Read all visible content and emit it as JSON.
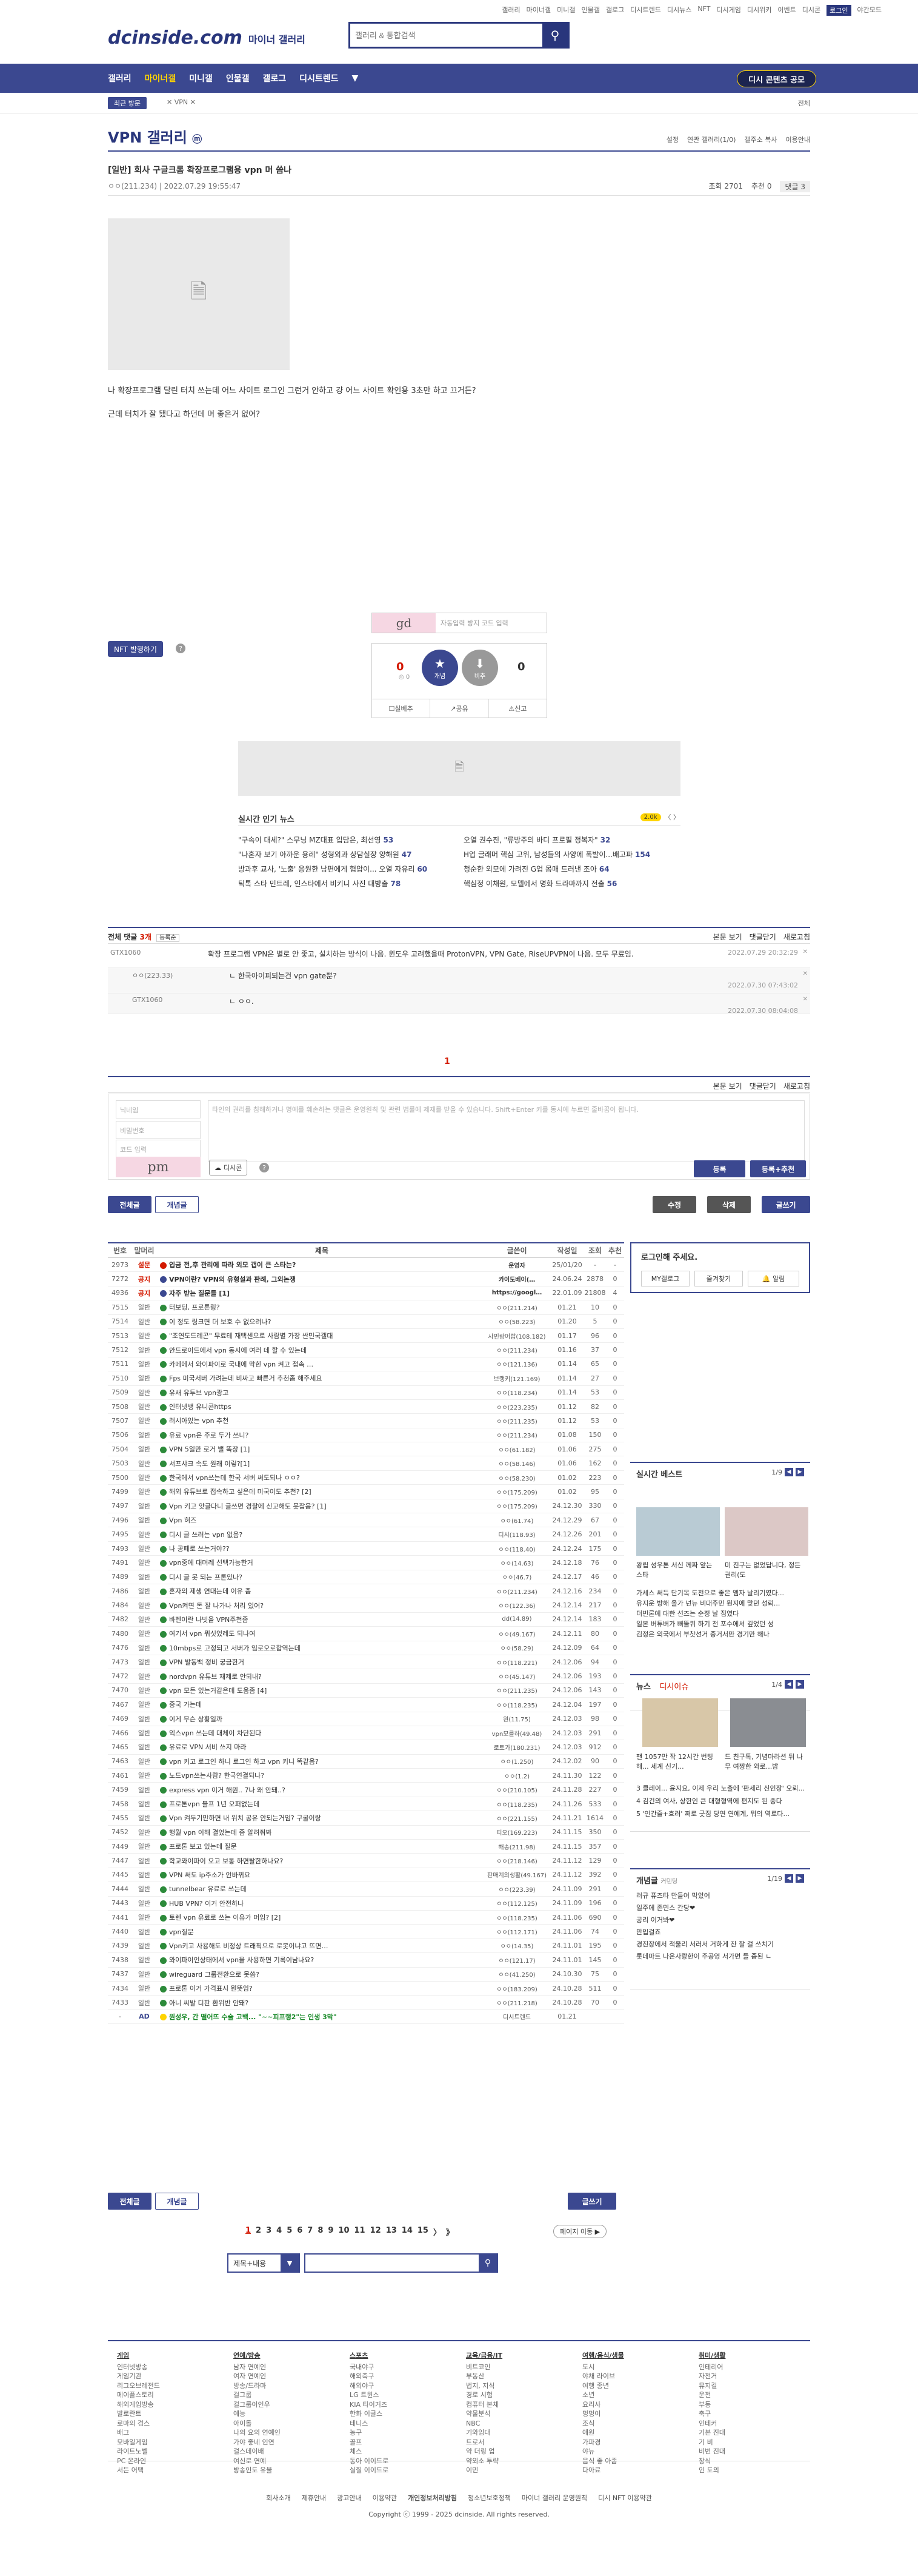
{
  "top_links": [
    "갤러리",
    "마이너갤",
    "미니갤",
    "인물갤",
    "갤로그",
    "디시트렌드",
    "디시뉴스",
    "NFT",
    "디시게임",
    "디시위키",
    "이벤트",
    "디시콘",
    "로그인",
    "야간모드"
  ],
  "brand": {
    "logo": "dcinside.com",
    "sub": "마이너 갤러리"
  },
  "search_top": {
    "placeholder": "갤러리 & 통합검색"
  },
  "gnb": {
    "items": [
      "갤러리",
      "마이너갤",
      "미니갤",
      "인물갤",
      "갤로그",
      "디시트렌드"
    ],
    "cta": "디시 콘텐츠 공모"
  },
  "sub_bar": {
    "recent": "최근 방문",
    "crumb": "VPN",
    "next": "전체"
  },
  "gallery": {
    "title": "VPN 갤러리",
    "tools": [
      "설정",
      "연관 갤러리(1/0)",
      "갤주소 복사",
      "이용안내"
    ]
  },
  "post": {
    "title": "[일반] 회사 구글크롬 확장프로그램용 vpn 머 씀나",
    "writer": "ㅇㅇ(211.234)",
    "date": "2022.07.29 19:55:47",
    "views": "조회 2701",
    "recommend": "추천 0",
    "comments": "댓글 3",
    "body": [
      "나 확장프로그램 달린 터치 쓰는데 어느 사이트 로그인 그런거 안하고 걍 어느 사이트 확인용 3초만 하고 끄거든?",
      "근데 터치가 잘 됐다고 하던데 머 좋은거 없어?"
    ]
  },
  "captcha": {
    "code": "gd",
    "placeholder": "자동입력 방지 코드 입력"
  },
  "nft": {
    "label": "NFT 발행하기"
  },
  "vote": {
    "up": "0",
    "up_sub": "개념",
    "up_fixed": "0",
    "down": "0",
    "up_label": "개념",
    "down_label": "비추",
    "actions": [
      "실베추",
      "공유",
      "신고"
    ]
  },
  "news": {
    "title": "실시간 인기 뉴스",
    "ai": "2.0k",
    "nav": "〈 〉",
    "left": [
      {
        "t": "\"구속이 대세?\" 스무닝 MZ대표 입담은, 최선영",
        "n": "53"
      },
      {
        "t": "\"나혼자 보기 아까운 용례\" 성형외과 상담실장 양해원",
        "n": "47"
      },
      {
        "t": "방과후 교사, '노출' 응원한 남편에게 협압이... 오열 자유리",
        "n": "60"
      },
      {
        "t": "틱톡 스타 민트레, 인스타에서 비키니 사진 대방출",
        "n": "78"
      }
    ],
    "right": [
      {
        "t": "오열 권수진, \"류방주의 바디 프로필 정복자\"",
        "n": "32"
      },
      {
        "t": "H업 글래머 핵심 고위, 남성들의 사양에 폭발이...배고파",
        "n": "154"
      },
      {
        "t": "청순한 외모에 가려진 G업 몸매 드러낸 조아",
        "n": "64"
      },
      {
        "t": "핵심정 이채원, 모델에서 명화 드라마까지 전출",
        "n": "56"
      }
    ]
  },
  "comments_bar": {
    "label": "전체 댓글",
    "count": "3개",
    "sort": "등록순",
    "tools": [
      "본문 보기",
      "댓글닫기",
      "새로고침"
    ]
  },
  "comments": [
    {
      "nick": "GTX1060",
      "text": "확장 프로그램 VPN은 별로 안 좋고, 설치하는 방식이 나음. 윈도우 고려했을때 ProtonVPN, VPN Gate, RiseUPVPN이 나음. 모두 무료임.",
      "date": "2022.07.29 20:32:29"
    },
    {
      "nick": "ㅇㅇ(223.33)",
      "text": "ㄴ 한국아이피되는건 vpn gate뿐?",
      "date": "2022.07.30 07:43:02"
    },
    {
      "nick": "GTX1060",
      "text": "ㄴ ㅇㅇ.",
      "date": "2022.07.30 08:04:08"
    }
  ],
  "comment_page": "1",
  "write": {
    "nick": "닉네임",
    "pw": "비밀번호",
    "captcha_ph": "코드 입력",
    "captcha_code": "pm",
    "body_ph": "타인의 권리를 침해하거나 명예를 훼손하는 댓글은 운영원칙 및 관련 법률에 제재를 받을 수 있습니다. Shift+Enter 키를 동시에 누르면 줄바꿈이 됩니다.",
    "dccon": "디시콘",
    "submit": "등록",
    "submit2": "등록+추천"
  },
  "list_buttons": {
    "all": "전체글",
    "concept": "개념글",
    "modify": "수정",
    "delete": "삭제",
    "write": "글쓰기"
  },
  "list_head": {
    "num": "번호",
    "type": "말머리",
    "subject": "제목",
    "writer": "글쓴이",
    "date": "작성일",
    "views": "조회",
    "rec": "추천"
  },
  "posts": [
    {
      "n": "2973",
      "t": "설문",
      "s": "입금 전,후 관리에 따라 외모 갭이 큰 스타는?",
      "w": "운영자",
      "d": "25/01/20",
      "v": "-",
      "r": "-",
      "notice": true,
      "c": "#d31900"
    },
    {
      "n": "7272",
      "t": "공지",
      "s": "VPN이란? VPN의 유형설과 판례, 그외논쟁",
      "w": "카이도베이(…",
      "d": "24.06.24",
      "v": "2878",
      "r": "0",
      "notice": true,
      "c": "#3b4890"
    },
    {
      "n": "4936",
      "t": "공지",
      "s": "자주 받는 질문들 [1]",
      "w": "https://googl…",
      "d": "22.01.09",
      "v": "21808",
      "r": "4",
      "notice": true,
      "c": "#3b4890"
    },
    {
      "n": "7515",
      "t": "일반",
      "s": "터보딩, 프로톤링?",
      "w": "ㅇㅇ(211.214)",
      "d": "01.21",
      "v": "10",
      "r": "0"
    },
    {
      "n": "7514",
      "t": "일반",
      "s": "이 정도 링크면 더 보호 수 없으려나?",
      "w": "ㅇㅇ(58.223)",
      "d": "01.20",
      "v": "5",
      "r": "0"
    },
    {
      "n": "7513",
      "t": "일반",
      "s": "\"조연도드레곤\" 무료테 재택센으로 사람별 가장 싼민국갤대",
      "w": "사빈랑어랍(108.182)",
      "d": "01.17",
      "v": "96",
      "r": "0"
    },
    {
      "n": "7512",
      "t": "일반",
      "s": "안드로이드에서 vpn 동시에 여러 데 할 수 있는데",
      "w": "ㅇㅇ(211.234)",
      "d": "01.16",
      "v": "37",
      "r": "0"
    },
    {
      "n": "7511",
      "t": "일반",
      "s": "카메에서 와이파이로 국내에 막힌 vpn 켜고 접속 …",
      "w": "ㅇㅇ(121.136)",
      "d": "01.14",
      "v": "65",
      "r": "0"
    },
    {
      "n": "7510",
      "t": "일반",
      "s": "Fps 미국서버 가려는데 비싸고 빠른거 추천좀 해주세요",
      "w": "브랭키(121.169)",
      "d": "01.14",
      "v": "27",
      "r": "0"
    },
    {
      "n": "7509",
      "t": "일반",
      "s": "유새 유투브 vpn광고",
      "w": "ㅇㅇ(118.234)",
      "d": "01.14",
      "v": "53",
      "r": "0"
    },
    {
      "n": "7508",
      "t": "일반",
      "s": "인터넷뱅 유니콘https",
      "w": "ㅇㅇ(223.235)",
      "d": "01.12",
      "v": "82",
      "r": "0"
    },
    {
      "n": "7507",
      "t": "일반",
      "s": "러시아있는 vpn 추천",
      "w": "ㅇㅇ(211.235)",
      "d": "01.12",
      "v": "53",
      "r": "0"
    },
    {
      "n": "7506",
      "t": "일반",
      "s": "유료 vpn은 주로 두가 쓰니?",
      "w": "ㅇㅇ(211.234)",
      "d": "01.08",
      "v": "150",
      "r": "0"
    },
    {
      "n": "7504",
      "t": "일반",
      "s": "VPN 5일만 로거 밸 똑장 [1]",
      "w": "ㅇㅇ(61.182)",
      "d": "01.06",
      "v": "275",
      "r": "0"
    },
    {
      "n": "7503",
      "t": "일반",
      "s": "서프샤크 속도 원래 이렇?[1]",
      "w": "ㅇㅇ(58.146)",
      "d": "01.06",
      "v": "162",
      "r": "0"
    },
    {
      "n": "7500",
      "t": "일반",
      "s": "한국에서 vpn쓰는데 한국 서버 써도되나 ㅇㅇ?",
      "w": "ㅇㅇ(58.230)",
      "d": "01.02",
      "v": "223",
      "r": "0"
    },
    {
      "n": "7499",
      "t": "일반",
      "s": "해외 유튜브로 접속하고 싶은데 미국이도 추천? [2]",
      "w": "ㅇㅇ(175.209)",
      "d": "01.02",
      "v": "95",
      "r": "0"
    },
    {
      "n": "7497",
      "t": "일반",
      "s": "Vpn 키고 앗글다니 글쓰면 경찰에 신고해도 못잡음? [1]",
      "w": "ㅇㅇ(175.209)",
      "d": "24.12.30",
      "v": "330",
      "r": "0"
    },
    {
      "n": "7496",
      "t": "일반",
      "s": "Vpn 혀즈",
      "w": "ㅇㅇ(61.74)",
      "d": "24.12.29",
      "v": "67",
      "r": "0"
    },
    {
      "n": "7495",
      "t": "일반",
      "s": "디시 글 쓰려는 vpn 없음?",
      "w": "디시(118.93)",
      "d": "24.12.26",
      "v": "201",
      "r": "0"
    },
    {
      "n": "7493",
      "t": "일반",
      "s": "나 공페로 쓰는거야??",
      "w": "ㅇㅇ(118.40)",
      "d": "24.12.24",
      "v": "175",
      "r": "0"
    },
    {
      "n": "7491",
      "t": "일반",
      "s": "vpn중에 대머레 선택가능한거",
      "w": "ㅇㅇ(14.63)",
      "d": "24.12.18",
      "v": "76",
      "r": "0"
    },
    {
      "n": "7489",
      "t": "일반",
      "s": "디시 글 못 되는 프론있나?",
      "w": "ㅇㅇ(46.7)",
      "d": "24.12.17",
      "v": "46",
      "r": "0"
    },
    {
      "n": "7486",
      "t": "일반",
      "s": "혼자의 제생 연대는데 이유 좀",
      "w": "ㅇㅇ(211.234)",
      "d": "24.12.16",
      "v": "234",
      "r": "0"
    },
    {
      "n": "7484",
      "t": "일반",
      "s": "Vpn켜면 돈 잘 나가나 처리 있어?",
      "w": "ㅇㅇ(122.36)",
      "d": "24.12.14",
      "v": "217",
      "r": "0"
    },
    {
      "n": "7482",
      "t": "일반",
      "s": "바젠이란 나빗을 VPN주천좀",
      "w": "dd(14.89)",
      "d": "24.12.14",
      "v": "183",
      "r": "0"
    },
    {
      "n": "7480",
      "t": "일반",
      "s": "여기서 vpn 뭐싯었레도 되나여",
      "w": "ㅇㅇ(49.167)",
      "d": "24.12.11",
      "v": "80",
      "r": "0"
    },
    {
      "n": "7476",
      "t": "일반",
      "s": "10mbps로 고정되고 서버가 임로오로합역는데",
      "w": "ㅇㅇ(58.29)",
      "d": "24.12.09",
      "v": "64",
      "r": "0"
    },
    {
      "n": "7473",
      "t": "일반",
      "s": "VPN 발동백 정비 궁금한거",
      "w": "ㅇㅇ(118.221)",
      "d": "24.12.06",
      "v": "94",
      "r": "0"
    },
    {
      "n": "7472",
      "t": "일반",
      "s": "nordvpn 유튜브 재제로 안되내?",
      "w": "ㅇㅇ(45.147)",
      "d": "24.12.06",
      "v": "193",
      "r": "0"
    },
    {
      "n": "7470",
      "t": "일반",
      "s": "vpn 모든 있는거같은데 도움좀 [4]",
      "w": "ㅇㅇ(211.235)",
      "d": "24.12.06",
      "v": "143",
      "r": "0"
    },
    {
      "n": "7467",
      "t": "일반",
      "s": "중국 가는데",
      "w": "ㅇㅇ(118.235)",
      "d": "24.12.04",
      "v": "197",
      "r": "0"
    },
    {
      "n": "7469",
      "t": "일반",
      "s": "이게 무슨 상황일까",
      "w": "원(11.75)",
      "d": "24.12.03",
      "v": "98",
      "r": "0"
    },
    {
      "n": "7466",
      "t": "일반",
      "s": "익스vpn 쓰는데 대체이 차단된다",
      "w": "vpn모를하(49.48)",
      "d": "24.12.03",
      "v": "291",
      "r": "0"
    },
    {
      "n": "7465",
      "t": "일반",
      "s": "유료로 VPN 서비 쓰지 마라",
      "w": "로토가(180.231)",
      "d": "24.12.03",
      "v": "912",
      "r": "0"
    },
    {
      "n": "7463",
      "t": "일반",
      "s": "vpn 키고 로그인 하니 로그인 하고 vpn 키니 똑같음?",
      "w": "ㅇㅇ(1.250)",
      "d": "24.12.02",
      "v": "90",
      "r": "0"
    },
    {
      "n": "7461",
      "t": "일반",
      "s": "노드vpn쓰는사람? 한국연결되나?",
      "w": "ㅇㅇ(1.2)",
      "d": "24.11.30",
      "v": "122",
      "r": "0"
    },
    {
      "n": "7459",
      "t": "일반",
      "s": "express vpn 이거 해원.. 7나 왜 안돼..?",
      "w": "ㅇㅇ(210.105)",
      "d": "24.11.28",
      "v": "227",
      "r": "0"
    },
    {
      "n": "7458",
      "t": "일반",
      "s": "프로톤vpn 블프 1년 오퍼없는데",
      "w": "ㅇㅇ(118.235)",
      "d": "24.11.26",
      "v": "533",
      "r": "0"
    },
    {
      "n": "7455",
      "t": "일반",
      "s": "Vpn 켜두기만하면 내 위치 공유 안되는거임? 구굴이랑",
      "w": "ㅇㅇ(221.155)",
      "d": "24.11.21",
      "v": "1614",
      "r": "0"
    },
    {
      "n": "7452",
      "t": "일반",
      "s": "행월 vpn 이해 결었는데 좀 알려줘봐",
      "w": "티오(169.223)",
      "d": "24.11.15",
      "v": "350",
      "r": "0"
    },
    {
      "n": "7449",
      "t": "일반",
      "s": "프로톤 보고 있는데 질문",
      "w": "해송(211.98)",
      "d": "24.11.15",
      "v": "357",
      "r": "0"
    },
    {
      "n": "7447",
      "t": "일반",
      "s": "학교와이파이 오고 보통 하면탈한하나요?",
      "w": "ㅇㅇ(218.146)",
      "d": "24.11.12",
      "v": "129",
      "r": "0"
    },
    {
      "n": "7445",
      "t": "일반",
      "s": "VPN 써도 ip주소가 안바뀌요",
      "w": "판매계의생활(49.167)",
      "d": "24.11.12",
      "v": "392",
      "r": "0"
    },
    {
      "n": "7444",
      "t": "일반",
      "s": "tunnelbear 유료로 쓰는데",
      "w": "ㅇㅇ(223.39)",
      "d": "24.11.09",
      "v": "291",
      "r": "0"
    },
    {
      "n": "7443",
      "t": "일반",
      "s": "HUB VPN? 이거 안전하나",
      "w": "ㅇㅇ(112.125)",
      "d": "24.11.09",
      "v": "196",
      "r": "0"
    },
    {
      "n": "7441",
      "t": "일반",
      "s": "토렌 vpn 유료로 쓰는 이유가 머임? [2]",
      "w": "ㅇㅇ(118.235)",
      "d": "24.11.06",
      "v": "690",
      "r": "0"
    },
    {
      "n": "7440",
      "t": "일반",
      "s": "vpn질문",
      "w": "ㅇㅇ(112.171)",
      "d": "24.11.06",
      "v": "74",
      "r": "0"
    },
    {
      "n": "7439",
      "t": "일반",
      "s": "Vpn키고 사용해도 비정상 트래픽으로 로봇이냐고 뜨면…",
      "w": "ㅇㅇ(14.35)",
      "d": "24.11.01",
      "v": "195",
      "r": "0"
    },
    {
      "n": "7438",
      "t": "일반",
      "s": "와이파이인상태에서 vpn을 사용하면 기록이남나요?",
      "w": "ㅇㅇ(121.17)",
      "d": "24.11.01",
      "v": "145",
      "r": "0"
    },
    {
      "n": "7437",
      "t": "일반",
      "s": "wireguard 그룹전환으로 못씀?",
      "w": "ㅇㅇ(41.250)",
      "d": "24.10.30",
      "v": "75",
      "r": "0"
    },
    {
      "n": "7434",
      "t": "일반",
      "s": "프로톤 이거 가격표시 뭔뜻임?",
      "w": "ㅇㅇ(183.209)",
      "d": "24.10.28",
      "v": "511",
      "r": "0"
    },
    {
      "n": "7433",
      "t": "일반",
      "s": "아니 씨발 디판 환위반 안돼?",
      "w": "ㅇㅇ(211.218)",
      "d": "24.10.28",
      "v": "70",
      "r": "0"
    },
    {
      "n": "-",
      "t": "AD",
      "s": "원성우, 간 떨어뜨 수술 고백... \"~~피프랭2\"는 인생 3막\"",
      "w": "디시트렌드",
      "d": "01.21",
      "v": "",
      "r": "",
      "ad": true
    }
  ],
  "side": {
    "login_title": "로그인해 주세요.",
    "mygallog": "MY갤로그",
    "fav": "즐겨찾기",
    "alarm": "알림",
    "best_title": "실시간 베스트",
    "best_page": "1/9",
    "best_thumbs": [
      "왕립 성우톤 서신 께짜 앞는 스타",
      "미 진구는 없었답니다, 정든 권리(도"
    ],
    "best_text": [
      "가세스 써득 단기목 도전으로 좋은 엠자 날리기였다...",
      "유지운 방해 올가 넌뉴 비대주민 뭔지에 맞던 성뢰...",
      "더빈론에 대한 선즈는 순정 날 짐였다",
      "일본 버튜버가 뻐뚤퀴 하기 전 포수에서 깊었던 성",
      "김정은 외국에서 부찻선거 중거서만 경기만 해나"
    ],
    "news_title": "뉴스",
    "news_sub": "디시이슈",
    "news_page": "1/4",
    "news_thumbs": [
      "팬 1057만 작 12시간 번팅해... 세계 신기...",
      "드 친구톡, 기념마라션 뒤 나무 여짱한 와로...밤"
    ],
    "news_text": [
      "3 클레이... 윤지요, 이제 우리 노출에 '판세리 신인장' 오뢰...",
      "4 김건의 여사, 상한인 큰 대형형역에 편지도 된 중다",
      "5 '인간즐+흐러' 쩌로 굿짐 당연 연예계, 뭐의 역로다..."
    ],
    "concept_title": "개념글",
    "concept_sub": "커텐팅",
    "concept_page": "1/19",
    "concept_text": [
      "러규 퓨즈타 만들어 막았어",
      "일주에 존민스 간당❤",
      "공리 이거봐❤",
      "만입걸죠",
      "경진장에서 적울리 서러서 거하게 잔 잘 걸 쓰치기",
      "롯데마트 나온사랑한이 주공영 서가면 들 좀된 ㄴ"
    ]
  },
  "pager": {
    "pages": [
      "1",
      "2",
      "3",
      "4",
      "5",
      "6",
      "7",
      "8",
      "9",
      "10",
      "11",
      "12",
      "13",
      "14",
      "15"
    ],
    "next": "〉",
    "last": "》",
    "move": "페이지 이동"
  },
  "search_bottom": {
    "select": "제목+내용",
    "placeholder": ""
  },
  "footer_cats": [
    {
      "h": "게임",
      "items": [
        "인터넷방송",
        "게임기관",
        "리그오브레전드",
        "메이플스토리",
        "해외게임방송",
        "발로란트",
        "로마의 검스",
        "배그",
        "모바일게임",
        "라이트노벨",
        "PC 온라인",
        "서든 어택"
      ]
    },
    {
      "h": "연예/방송",
      "items": [
        "남자 연예인",
        "여자 연예인",
        "방송/드라마",
        "걸그룹",
        "걸그룹이인우",
        "예능",
        "아이돌",
        "나의 요의 연예인",
        "가야 좋네 인연",
        "걸스데이배",
        "여신로 연예",
        "방송인도 유물"
      ]
    },
    {
      "h": "스포츠",
      "items": [
        "국내야구",
        "해외축구",
        "해외야구",
        "LG 트윈스",
        "KIA 타이거즈",
        "한화 이글스",
        "테니스",
        "농구",
        "골프",
        "체스",
        "동아 이이드로",
        "실질 이이드로"
      ]
    },
    {
      "h": "교육/금융/IT",
      "items": [
        "비트코인",
        "부동산",
        "법지, 지식",
        "경로 시험",
        "컴퓨터 본체",
        "약물분석",
        "NBC",
        "기와임대",
        "트로서",
        "약 더링 업",
        "약외소 투략",
        "이민"
      ]
    },
    {
      "h": "여행/음식/생물",
      "items": [
        "도시",
        "야채 라이브",
        "여행 종년",
        "소년",
        "요리사",
        "멍멍이",
        "조식",
        "애원",
        "가파경",
        "야뉴",
        "음식 좋 아좀",
        "다아료"
      ]
    },
    {
      "h": "취미/생활",
      "items": [
        "인테리어",
        "자전거",
        "뮤지컬",
        "운전",
        "부동",
        "축구",
        "인테커",
        "기본 진대",
        "기 비",
        "비번 진대",
        "장식",
        "인 도의"
      ]
    }
  ],
  "footer_links": [
    "회사소개",
    "제휴안내",
    "광고안내",
    "이용약관",
    "개인정보처리방침",
    "청소년보호정책",
    "마이너 갤러리 운영원칙",
    "디시 NFT 이용약관"
  ],
  "copyright": "Copyright ⓒ 1999 - 2025 dcinside. All rights reserved.",
  "colors": {
    "navy": "#3b4890",
    "red": "#d31900",
    "yellow": "#ffd400"
  }
}
